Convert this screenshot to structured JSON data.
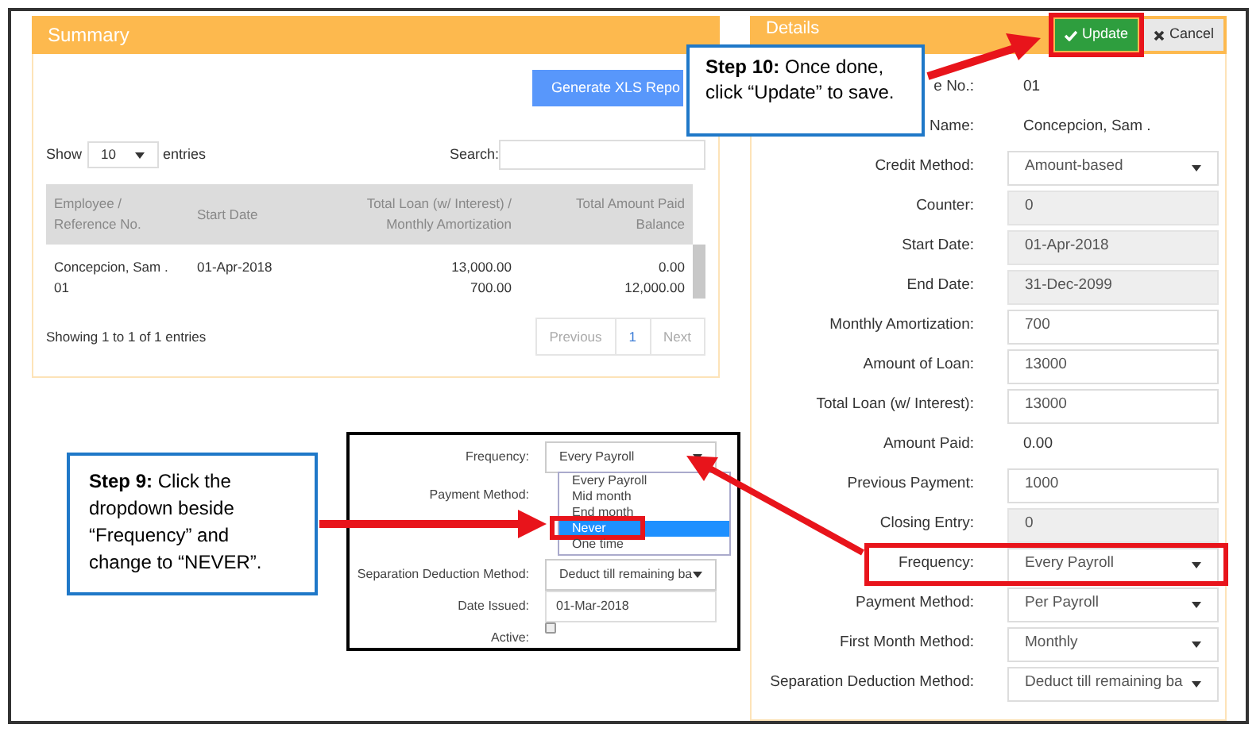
{
  "summary": {
    "title": "Summary",
    "report_button": "Generate XLS Repo",
    "show_label": "Show",
    "page_size": "10",
    "entries_label": "entries",
    "search_label": "Search:",
    "columns": [
      "Employee / Reference No.",
      "Start Date",
      "Total Loan (w/ Interest) / Monthly Amortization",
      "Total Amount Paid Balance"
    ],
    "rows": [
      [
        [
          "Concepcion, Sam .",
          "01"
        ],
        [
          "01-Apr-2018"
        ],
        [
          "13,000.00",
          "700.00"
        ],
        [
          "0.00",
          "12,000.00"
        ]
      ]
    ],
    "info": "Showing 1 to 1 of 1 entries",
    "pagination": [
      {
        "label": "Previous",
        "disabled": true
      },
      {
        "label": "1",
        "disabled": false
      },
      {
        "label": "Next",
        "disabled": true
      }
    ]
  },
  "details": {
    "title": "Details",
    "buttons": [
      {
        "kind": "update",
        "label": "Update",
        "highlighted": true
      },
      {
        "kind": "cancel",
        "label": "Cancel",
        "highlighted": false
      }
    ],
    "fields": [
      {
        "label": "e No.:",
        "kind": "static",
        "value": "01",
        "highlighted": false
      },
      {
        "label": "Name:",
        "kind": "static",
        "value": "Concepcion, Sam .",
        "highlighted": false
      },
      {
        "label": "Credit Method:",
        "kind": "select",
        "value": "Amount-based",
        "highlighted": false
      },
      {
        "label": "Counter:",
        "kind": "readonly",
        "value": "0",
        "highlighted": false
      },
      {
        "label": "Start Date:",
        "kind": "readonly",
        "value": "01-Apr-2018",
        "highlighted": false
      },
      {
        "label": "End Date:",
        "kind": "readonly",
        "value": "31-Dec-2099",
        "highlighted": false
      },
      {
        "label": "Monthly Amortization:",
        "kind": "input",
        "value": "700",
        "highlighted": false
      },
      {
        "label": "Amount of Loan:",
        "kind": "input",
        "value": "13000",
        "highlighted": false
      },
      {
        "label": "Total Loan (w/ Interest):",
        "kind": "input",
        "value": "13000",
        "highlighted": false
      },
      {
        "label": "Amount Paid:",
        "kind": "static",
        "value": "0.00",
        "highlighted": false
      },
      {
        "label": "Previous Payment:",
        "kind": "input",
        "value": "1000",
        "highlighted": false
      },
      {
        "label": "Closing Entry:",
        "kind": "readonly",
        "value": "0",
        "highlighted": false
      },
      {
        "label": "Frequency:",
        "kind": "select",
        "value": "Every Payroll",
        "highlighted": true
      },
      {
        "label": "Payment Method:",
        "kind": "select",
        "value": "Per Payroll",
        "highlighted": false
      },
      {
        "label": "First Month Method:",
        "kind": "select",
        "value": "Monthly",
        "highlighted": false
      },
      {
        "label": "Separation Deduction Method:",
        "kind": "select",
        "value": "Deduct till remaining ba",
        "highlighted": false
      }
    ]
  },
  "inset": {
    "fields": [
      {
        "label": "Frequency:",
        "kind": "select",
        "value": "Every Payroll"
      },
      {
        "label": "Payment Method:",
        "kind": "covered"
      },
      {
        "kind": "covered"
      },
      {
        "label": "Separation Deduction Method:",
        "kind": "select",
        "value": "Deduct till remaining ba"
      },
      {
        "label": "Date Issued:",
        "kind": "input",
        "value": "01-Mar-2018"
      },
      {
        "label": "Active:",
        "kind": "checkbox",
        "checked": false
      }
    ],
    "options": [
      {
        "label": "Every Payroll",
        "selected": false,
        "highlighted": false
      },
      {
        "label": "Mid month",
        "selected": false,
        "highlighted": false
      },
      {
        "label": "End month",
        "selected": false,
        "highlighted": false
      },
      {
        "label": "Never",
        "selected": true,
        "highlighted": true
      },
      {
        "label": "One time",
        "selected": false,
        "highlighted": false
      }
    ]
  },
  "callouts": [
    {
      "text": "**Step 10:** Once done, click “Update” to save."
    },
    {
      "text": "**Step 9:** Click the dropdown beside “Frequency” and change to “NEVER”."
    }
  ]
}
